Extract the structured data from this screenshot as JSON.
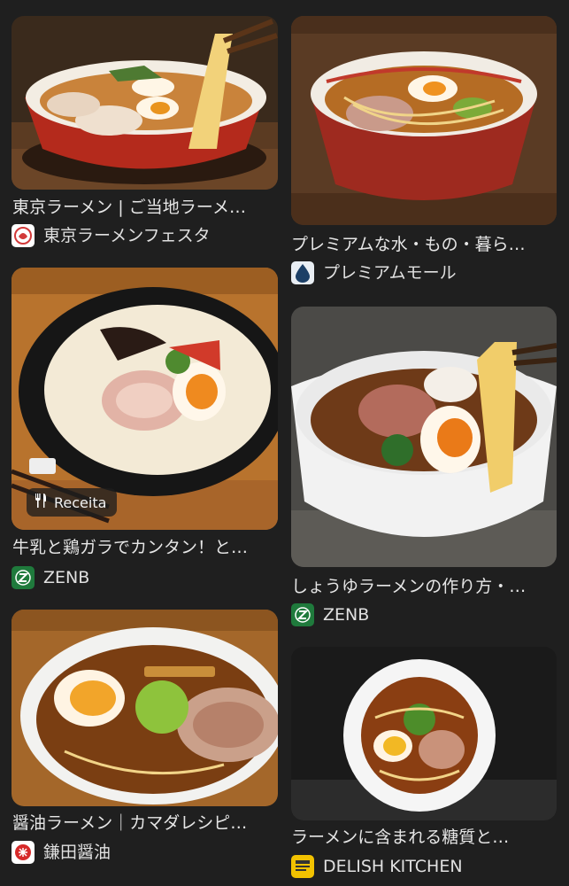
{
  "results": [
    {
      "title": "東京ラーメン | ご当地ラーメ…",
      "source": "東京ラーメンフェスタ"
    },
    {
      "title": "プレミアムな水・もの・暮ら…",
      "source": "プレミアムモール"
    },
    {
      "title": "牛乳と鶏ガラでカンタン！と…",
      "source": "ZENB",
      "badge": "Receita"
    },
    {
      "title": "しょうゆラーメンの作り方・…",
      "source": "ZENB"
    },
    {
      "title": "醤油ラーメン｜カマダレシピ…",
      "source": "鎌田醤油"
    },
    {
      "title": "ラーメンに含まれる糖質と…",
      "source": "DELISH KITCHEN"
    }
  ],
  "icons": {
    "tokyo": "ramen-fes-favicon",
    "premium": "water-drop-favicon",
    "zenb": "zenb-favicon",
    "kamada": "kamada-favicon",
    "delish": "delish-kitchen-favicon",
    "recipe": "fork-knife-icon"
  },
  "colors": {
    "background": "#1f1f1f",
    "text": "#e6e6e6",
    "zenb_green": "#1f7a3c"
  }
}
